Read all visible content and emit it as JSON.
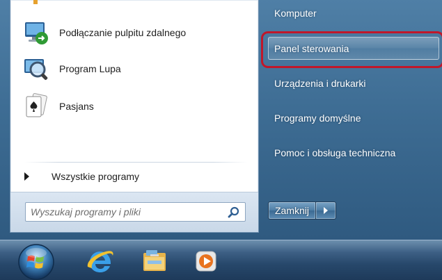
{
  "start_menu": {
    "programs": [
      {
        "label": "Podłączanie pulpitu zdalnego",
        "icon": "remote-desktop-icon"
      },
      {
        "label": "Program Lupa",
        "icon": "magnifier-icon"
      },
      {
        "label": "Pasjans",
        "icon": "solitaire-icon"
      }
    ],
    "all_programs_label": "Wszystkie programy",
    "search": {
      "placeholder": "Wyszukaj programy i pliki",
      "value": ""
    },
    "right_items": [
      {
        "label": "Komputer"
      },
      {
        "label": "Panel sterowania",
        "selected": true
      },
      {
        "label": "Urządzenia i drukarki"
      },
      {
        "label": "Programy domyślne"
      },
      {
        "label": "Pomoc i obsługa techniczna"
      }
    ],
    "shutdown_label": "Zamknij",
    "highlight_color": "#c0172a"
  },
  "taskbar": {
    "icons": [
      "windows-start-orb-icon",
      "internet-explorer-icon",
      "windows-explorer-icon",
      "media-player-icon"
    ]
  }
}
